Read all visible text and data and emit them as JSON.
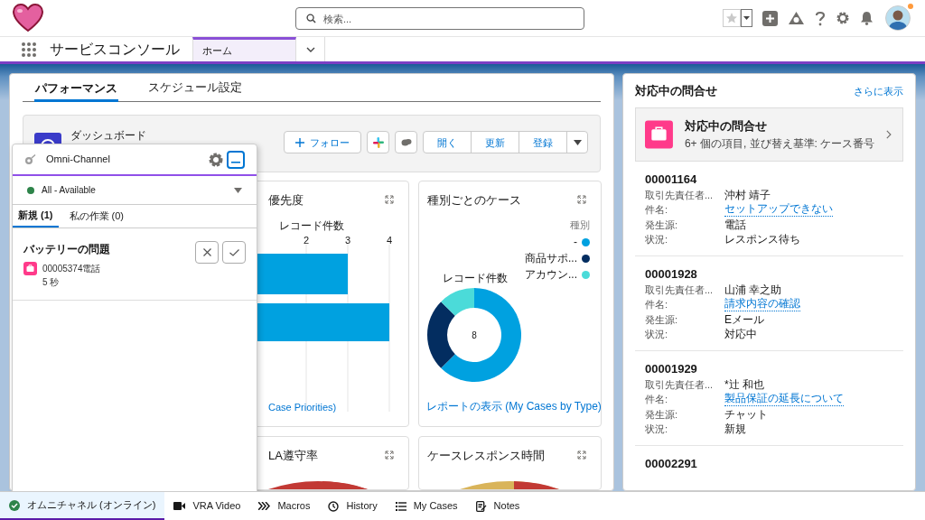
{
  "header": {
    "search": {
      "placeholder": "検索..."
    }
  },
  "nav": {
    "app_title": "サービスコンソール",
    "tabs": [
      {
        "label": "ホーム",
        "selected": true
      }
    ]
  },
  "main": {
    "tabs": [
      {
        "label": "パフォーマンス",
        "selected": true
      },
      {
        "label": "スケジュール設定",
        "selected": false
      }
    ],
    "dashboard": {
      "label": "ダッシュボード",
      "follow": "フォロー",
      "buttons": [
        "開く",
        "更新",
        "登録"
      ]
    },
    "cards": [
      {
        "kind": "chart",
        "title": "優先度",
        "link": "Case Priorities)",
        "chart_data": {
          "type": "bar",
          "orientation": "horizontal",
          "xlabel": "レコード件数",
          "values": [
            3,
            4
          ],
          "xlim": [
            0,
            4
          ],
          "xticks": [
            2,
            3,
            4
          ],
          "grid": true
        }
      },
      {
        "kind": "chart",
        "title": "種別ごとのケース",
        "total": "8",
        "link": "レポートの表示 (My Cases by Type)",
        "chart_data": {
          "type": "donut",
          "categories": [
            "-",
            "商品サポ...",
            "アカウン..."
          ],
          "legend": {
            "title": "種別"
          },
          "series": [
            {
              "name": "レコード件数",
              "values": [
                62.5,
                25,
                12.5
              ],
              "colors": [
                "#00a1e0",
                "#032d60",
                "#4bdbd9"
              ]
            }
          ]
        }
      },
      {
        "kind": "gauge",
        "title": "LA遵守率"
      },
      {
        "kind": "gauge",
        "title": "ケースレスポンス時間"
      }
    ]
  },
  "omni": {
    "title": "Omni-Channel",
    "status": {
      "label": "All - Available",
      "color": "#2e844a"
    },
    "tabs": [
      {
        "label": "新規 (1)",
        "selected": true
      },
      {
        "label": "私の作業 (0)",
        "selected": false
      }
    ],
    "work_item": {
      "title": "バッテリーの問題",
      "number": "00005374電話",
      "time": "5 秒"
    }
  },
  "side": {
    "title": "対応中の問合せ",
    "more": "さらに表示",
    "list_title": "対応中の問合せ",
    "list_subtitle": "6+ 個の項目, 並び替え基準: ケース番号",
    "cases": [
      {
        "number": "00001164",
        "fields": [
          {
            "label": "取引先責任者...",
            "value": "沖村 靖子",
            "kind": "text"
          },
          {
            "label": "件名:",
            "value": "セットアップできない",
            "kind": "link"
          },
          {
            "label": "発生源:",
            "value": "電話",
            "kind": "text"
          },
          {
            "label": "状況:",
            "value": "レスポンス待ち",
            "kind": "text"
          }
        ]
      },
      {
        "number": "00001928",
        "fields": [
          {
            "label": "取引先責任者...",
            "value": "山浦 幸之助",
            "kind": "text"
          },
          {
            "label": "件名:",
            "value": "請求内容の確認",
            "kind": "link"
          },
          {
            "label": "発生源:",
            "value": "Eメール",
            "kind": "text"
          },
          {
            "label": "状況:",
            "value": "対応中",
            "kind": "text"
          }
        ]
      },
      {
        "number": "00001929",
        "fields": [
          {
            "label": "取引先責任者...",
            "value": "*辻 和也",
            "kind": "text"
          },
          {
            "label": "件名:",
            "value": "製品保証の延長について",
            "kind": "link"
          },
          {
            "label": "発生源:",
            "value": "チャット",
            "kind": "text"
          },
          {
            "label": "状況:",
            "value": "新規",
            "kind": "text"
          }
        ]
      },
      {
        "number": "00002291"
      }
    ]
  },
  "utility_bar": [
    {
      "label": "オムニチャネル (オンライン)",
      "selected": true
    },
    {
      "label": "VRA Video",
      "selected": false
    },
    {
      "label": "Macros",
      "selected": false
    },
    {
      "label": "History",
      "selected": false
    },
    {
      "label": "My Cases",
      "selected": false
    },
    {
      "label": "Notes",
      "selected": false
    }
  ]
}
